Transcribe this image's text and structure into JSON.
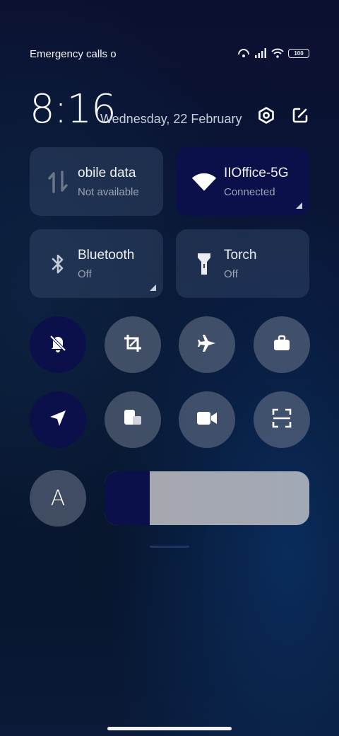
{
  "status_bar": {
    "carrier_text": "Emergency calls o",
    "battery": "100",
    "icons": [
      "hotspot-icon",
      "signal-icon",
      "wifi-icon",
      "battery-icon"
    ]
  },
  "header": {
    "time": "8:16",
    "date": "Wednesday, 22 February",
    "actions": [
      "settings-icon",
      "edit-icon"
    ]
  },
  "tiles": [
    {
      "id": "mobile-data",
      "title": "obile data",
      "subtitle": "Not available",
      "active": false,
      "icon": "mobile-data-icon"
    },
    {
      "id": "wifi",
      "title": "IIOffice-5G",
      "subtitle": "Connected",
      "active": true,
      "icon": "wifi-icon"
    },
    {
      "id": "bluetooth",
      "title": "Bluetooth",
      "subtitle": "Off",
      "active": false,
      "icon": "bluetooth-icon"
    },
    {
      "id": "torch",
      "title": "Torch",
      "subtitle": "Off",
      "active": false,
      "icon": "torch-icon"
    }
  ],
  "toggles": [
    {
      "id": "silent",
      "icon": "bell-off-icon",
      "active": true
    },
    {
      "id": "screenshot-crop",
      "icon": "crop-icon",
      "active": false
    },
    {
      "id": "airplane",
      "icon": "airplane-icon",
      "active": false
    },
    {
      "id": "work",
      "icon": "briefcase-icon",
      "active": false
    },
    {
      "id": "location",
      "icon": "location-arrow-icon",
      "active": true
    },
    {
      "id": "floating-window",
      "icon": "floating-window-icon",
      "active": false
    },
    {
      "id": "screen-recorder",
      "icon": "video-camera-icon",
      "active": false
    },
    {
      "id": "scanner",
      "icon": "scan-icon",
      "active": false
    }
  ],
  "auto_brightness": {
    "label": "A",
    "icon": "auto-brightness-icon"
  },
  "brightness": {
    "level_percent": 22
  },
  "colors": {
    "active": "#0b0f4a",
    "tile_inactive": "rgba(70,90,120,0.35)"
  }
}
